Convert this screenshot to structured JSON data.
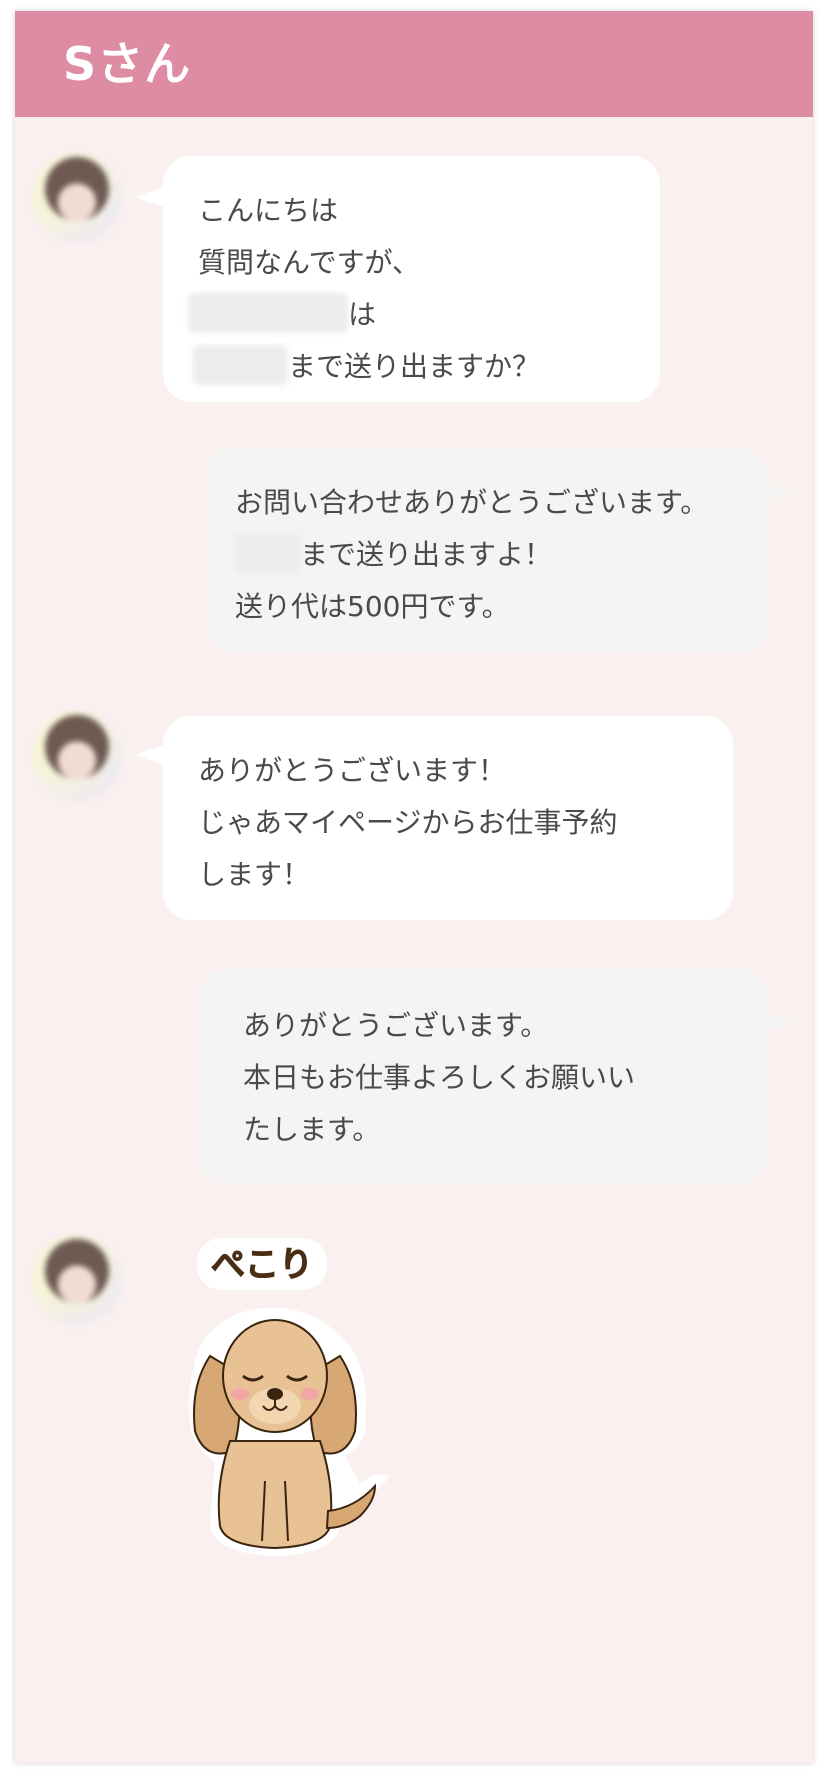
{
  "header": {
    "title": "Sさん"
  },
  "messages": [
    {
      "sender": "user",
      "lines": [
        "こんにちは",
        "質問なんですが、",
        "は",
        "まで送り出ますか？"
      ]
    },
    {
      "sender": "staff",
      "lines": [
        "お問い合わせありがとうございます。",
        "まで送り出ますよ！",
        "送り代は500円です。"
      ]
    },
    {
      "sender": "user",
      "lines": [
        "ありがとうございます！",
        "じゃあマイページからお仕事予約",
        "します！"
      ]
    },
    {
      "sender": "staff",
      "lines": [
        "ありがとうございます。",
        "本日もお仕事よろしくお願いい",
        "たします。"
      ]
    }
  ],
  "sticker": {
    "text": "ぺこり",
    "icon": "bowing-dog-icon"
  },
  "colors": {
    "header": "#dd8ca4",
    "background": "#fbf0f0",
    "user_bubble": "#ffffff",
    "staff_bubble": "#f4f4f4",
    "text": "#4a4a4a"
  }
}
